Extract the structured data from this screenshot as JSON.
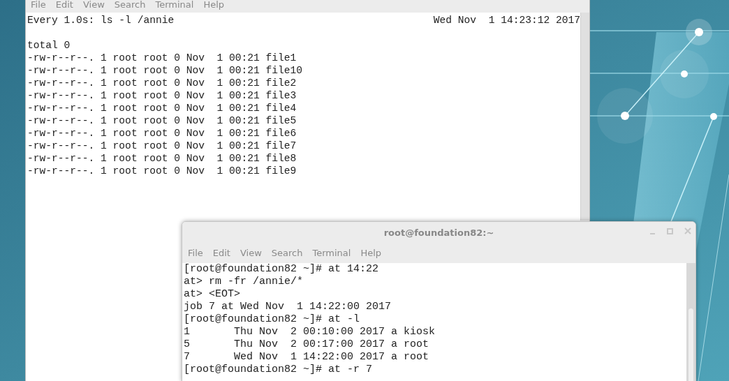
{
  "back_terminal": {
    "menu": [
      "File",
      "Edit",
      "View",
      "Search",
      "Terminal",
      "Help"
    ],
    "watch_header": {
      "command": "Every 1.0s: ls -l /annie",
      "timestamp": "Wed Nov  1 14:23:12 2017"
    },
    "lines": [
      "total 0",
      "-rw-r--r--. 1 root root 0 Nov  1 00:21 file1",
      "-rw-r--r--. 1 root root 0 Nov  1 00:21 file10",
      "-rw-r--r--. 1 root root 0 Nov  1 00:21 file2",
      "-rw-r--r--. 1 root root 0 Nov  1 00:21 file3",
      "-rw-r--r--. 1 root root 0 Nov  1 00:21 file4",
      "-rw-r--r--. 1 root root 0 Nov  1 00:21 file5",
      "-rw-r--r--. 1 root root 0 Nov  1 00:21 file6",
      "-rw-r--r--. 1 root root 0 Nov  1 00:21 file7",
      "-rw-r--r--. 1 root root 0 Nov  1 00:21 file8",
      "-rw-r--r--. 1 root root 0 Nov  1 00:21 file9"
    ]
  },
  "front_terminal": {
    "title": "root@foundation82:~",
    "menu": [
      "File",
      "Edit",
      "View",
      "Search",
      "Terminal",
      "Help"
    ],
    "lines": [
      "[root@foundation82 ~]# at 14:22",
      "at> rm -fr /annie/*",
      "at> <EOT>",
      "job 7 at Wed Nov  1 14:22:00 2017",
      "[root@foundation82 ~]# at -l",
      "1\tThu Nov  2 00:10:00 2017 a kiosk",
      "5\tThu Nov  2 00:17:00 2017 a root",
      "7\tWed Nov  1 14:22:00 2017 a root",
      "[root@foundation82 ~]# at -r 7"
    ]
  }
}
